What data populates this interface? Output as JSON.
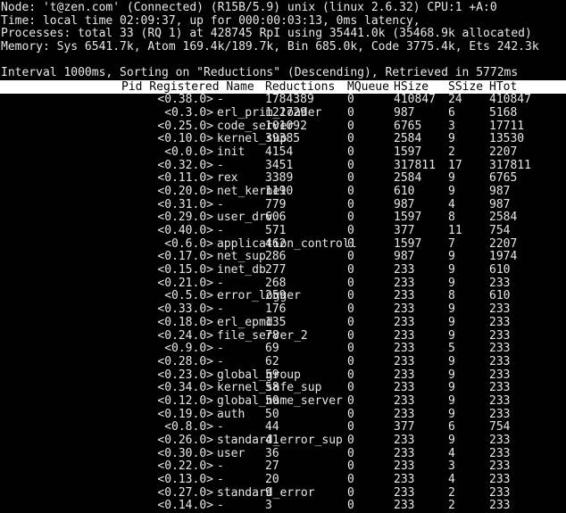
{
  "terminal": {
    "background": "#000000",
    "foreground": "#e8e8e8",
    "header_background": "#ffffff",
    "header_foreground": "#000000"
  },
  "summary": {
    "node_line": "Node: 't@zen.com' (Connected) (R15B/5.9) unix (linux 2.6.32) CPU:1 +A:0",
    "time_line": "Time: local time 02:09:37, up for 000:00:03:13, 0ms latency,",
    "processes_line": "Processes: total 33 (RQ 1) at 428745 RpI using 35441.0k (35468.9k allocated)",
    "memory_line": "Memory: Sys 6541.7k, Atom 169.4k/189.7k, Bin 685.0k, Code 3775.4k, Ets 242.3k"
  },
  "status": {
    "interval_line": "Interval 1000ms, Sorting on \"Reductions\" (Descending), Retrieved in 5772ms",
    "interval_ms": "1000ms",
    "sort_column": "Reductions",
    "sort_direction": "Descending",
    "retrieved_in": "5772ms"
  },
  "table": {
    "columns": {
      "pid_name": "Pid Registered Name",
      "pid": "Pid",
      "name": "Registered Name",
      "reductions": "Reductions",
      "mqueue": "MQueue",
      "hsize": "HSize",
      "ssize": "SSize",
      "htot": "HTot"
    },
    "rows": [
      {
        "pid": "<0.38.0>",
        "name": "-",
        "reductions": "1784389",
        "mqueue": "0",
        "hsize": "410847",
        "ssize": "24",
        "htot": "410847"
      },
      {
        "pid": "<0.3.0>",
        "name": "erl_prim_loader",
        "reductions": "122729",
        "mqueue": "0",
        "hsize": "987",
        "ssize": "6",
        "htot": "5168"
      },
      {
        "pid": "<0.25.0>",
        "name": "code_server",
        "reductions": "101092",
        "mqueue": "0",
        "hsize": "6765",
        "ssize": "3",
        "htot": "17711"
      },
      {
        "pid": "<0.10.0>",
        "name": "kernel_sup",
        "reductions": "39385",
        "mqueue": "0",
        "hsize": "2584",
        "ssize": "9",
        "htot": "13530"
      },
      {
        "pid": "<0.0.0>",
        "name": "init",
        "reductions": "4154",
        "mqueue": "0",
        "hsize": "1597",
        "ssize": "2",
        "htot": "2207"
      },
      {
        "pid": "<0.32.0>",
        "name": "-",
        "reductions": "3451",
        "mqueue": "0",
        "hsize": "317811",
        "ssize": "17",
        "htot": "317811"
      },
      {
        "pid": "<0.11.0>",
        "name": "rex",
        "reductions": "3389",
        "mqueue": "0",
        "hsize": "2584",
        "ssize": "9",
        "htot": "6765"
      },
      {
        "pid": "<0.20.0>",
        "name": "net_kernel",
        "reductions": "1190",
        "mqueue": "0",
        "hsize": "610",
        "ssize": "9",
        "htot": "987"
      },
      {
        "pid": "<0.31.0>",
        "name": "-",
        "reductions": "779",
        "mqueue": "0",
        "hsize": "987",
        "ssize": "4",
        "htot": "987"
      },
      {
        "pid": "<0.29.0>",
        "name": "user_drv",
        "reductions": "606",
        "mqueue": "0",
        "hsize": "1597",
        "ssize": "8",
        "htot": "2584"
      },
      {
        "pid": "<0.40.0>",
        "name": "-",
        "reductions": "571",
        "mqueue": "0",
        "hsize": "377",
        "ssize": "11",
        "htot": "754"
      },
      {
        "pid": "<0.6.0>",
        "name": "application_controll",
        "reductions": "462",
        "mqueue": "0",
        "hsize": "1597",
        "ssize": "7",
        "htot": "2207"
      },
      {
        "pid": "<0.17.0>",
        "name": "net_sup",
        "reductions": "286",
        "mqueue": "0",
        "hsize": "987",
        "ssize": "9",
        "htot": "1974"
      },
      {
        "pid": "<0.15.0>",
        "name": "inet_db",
        "reductions": "277",
        "mqueue": "0",
        "hsize": "233",
        "ssize": "9",
        "htot": "610"
      },
      {
        "pid": "<0.21.0>",
        "name": "-",
        "reductions": "268",
        "mqueue": "0",
        "hsize": "233",
        "ssize": "9",
        "htot": "233"
      },
      {
        "pid": "<0.5.0>",
        "name": "error_logger",
        "reductions": "259",
        "mqueue": "0",
        "hsize": "233",
        "ssize": "8",
        "htot": "610"
      },
      {
        "pid": "<0.33.0>",
        "name": "-",
        "reductions": "176",
        "mqueue": "0",
        "hsize": "233",
        "ssize": "9",
        "htot": "233"
      },
      {
        "pid": "<0.18.0>",
        "name": "erl_epmd",
        "reductions": "135",
        "mqueue": "0",
        "hsize": "233",
        "ssize": "9",
        "htot": "233"
      },
      {
        "pid": "<0.24.0>",
        "name": "file_server_2",
        "reductions": "78",
        "mqueue": "0",
        "hsize": "233",
        "ssize": "9",
        "htot": "233"
      },
      {
        "pid": "<0.9.0>",
        "name": "-",
        "reductions": "69",
        "mqueue": "0",
        "hsize": "233",
        "ssize": "5",
        "htot": "233"
      },
      {
        "pid": "<0.28.0>",
        "name": "-",
        "reductions": "62",
        "mqueue": "0",
        "hsize": "233",
        "ssize": "9",
        "htot": "233"
      },
      {
        "pid": "<0.23.0>",
        "name": "global_group",
        "reductions": "59",
        "mqueue": "0",
        "hsize": "233",
        "ssize": "9",
        "htot": "233"
      },
      {
        "pid": "<0.34.0>",
        "name": "kernel_safe_sup",
        "reductions": "58",
        "mqueue": "0",
        "hsize": "233",
        "ssize": "9",
        "htot": "233"
      },
      {
        "pid": "<0.12.0>",
        "name": "global_name_server",
        "reductions": "50",
        "mqueue": "0",
        "hsize": "233",
        "ssize": "9",
        "htot": "233"
      },
      {
        "pid": "<0.19.0>",
        "name": "auth",
        "reductions": "50",
        "mqueue": "0",
        "hsize": "233",
        "ssize": "9",
        "htot": "233"
      },
      {
        "pid": "<0.8.0>",
        "name": "-",
        "reductions": "44",
        "mqueue": "0",
        "hsize": "377",
        "ssize": "6",
        "htot": "754"
      },
      {
        "pid": "<0.26.0>",
        "name": "standard_error_sup",
        "reductions": "41",
        "mqueue": "0",
        "hsize": "233",
        "ssize": "9",
        "htot": "233"
      },
      {
        "pid": "<0.30.0>",
        "name": "user",
        "reductions": "36",
        "mqueue": "0",
        "hsize": "233",
        "ssize": "4",
        "htot": "233"
      },
      {
        "pid": "<0.22.0>",
        "name": "-",
        "reductions": "27",
        "mqueue": "0",
        "hsize": "233",
        "ssize": "3",
        "htot": "233"
      },
      {
        "pid": "<0.13.0>",
        "name": "-",
        "reductions": "20",
        "mqueue": "0",
        "hsize": "233",
        "ssize": "4",
        "htot": "233"
      },
      {
        "pid": "<0.27.0>",
        "name": "standard_error",
        "reductions": "9",
        "mqueue": "0",
        "hsize": "233",
        "ssize": "2",
        "htot": "233"
      },
      {
        "pid": "<0.14.0>",
        "name": "-",
        "reductions": "3",
        "mqueue": "0",
        "hsize": "233",
        "ssize": "2",
        "htot": "233"
      }
    ]
  }
}
